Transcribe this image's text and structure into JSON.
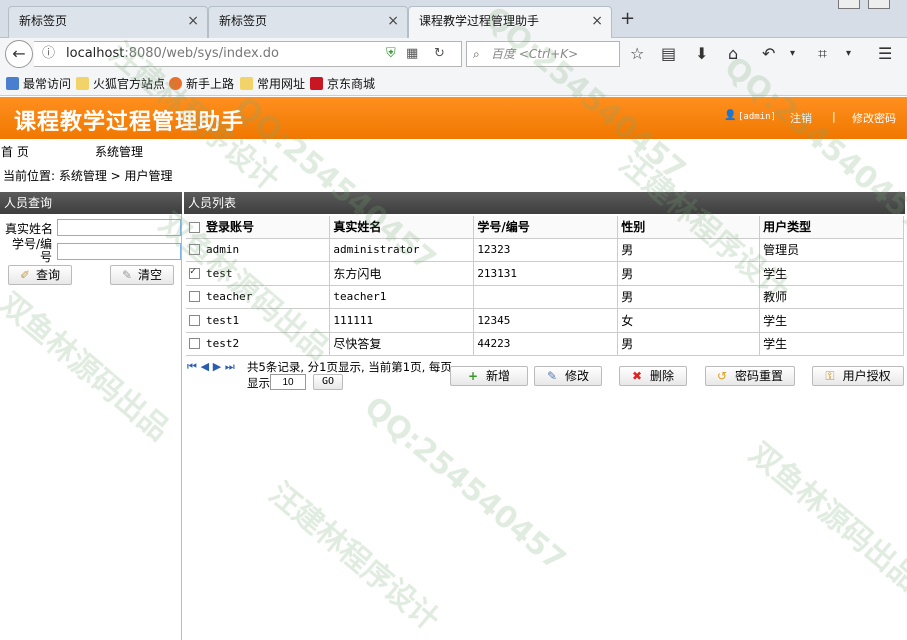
{
  "browser": {
    "tabs": [
      {
        "label": "新标签页",
        "active": false
      },
      {
        "label": "新标签页",
        "active": false
      },
      {
        "label": "课程教学过程管理助手",
        "active": true
      }
    ],
    "url_host": "localhost",
    "url_rest": ":8080/web/sys/index.do",
    "search_placeholder": "百度 <Ctrl+K>",
    "bookmarks": [
      "最常访问",
      "火狐官方站点",
      "新手上路",
      "常用网址",
      "京东商城"
    ]
  },
  "app": {
    "title": "课程教学过程管理助手",
    "user": "[admin]",
    "logout": "注销",
    "separator": "|",
    "change_password": "修改密码",
    "menu": [
      "首 页",
      "系统管理"
    ],
    "breadcrumb": "当前位置: 系统管理 > 用户管理"
  },
  "query_panel": {
    "title": "人员查询",
    "name_label": "真实姓名",
    "id_label": "学号/编号",
    "name_value": "",
    "id_value": "",
    "query_button": "查询",
    "clear_button": "清空"
  },
  "list_panel": {
    "title": "人员列表",
    "columns": [
      "登录账号",
      "真实姓名",
      "学号/编号",
      "性别",
      "用户类型"
    ],
    "rows": [
      {
        "checked": false,
        "account": "admin",
        "name": "administrator",
        "number": "12323",
        "gender": "男",
        "type": "管理员"
      },
      {
        "checked": true,
        "account": "test",
        "name": "东方闪电",
        "number": "213131",
        "gender": "男",
        "type": "学生"
      },
      {
        "checked": false,
        "account": "teacher",
        "name": "teacher1",
        "number": "",
        "gender": "男",
        "type": "教师"
      },
      {
        "checked": false,
        "account": "test1",
        "name": "111111",
        "number": "12345",
        "gender": "女",
        "type": "学生"
      },
      {
        "checked": false,
        "account": "test2",
        "name": "尽快答复",
        "number": "44223",
        "gender": "男",
        "type": "学生"
      }
    ],
    "pager_text": "共5条记录, 分1页显示, 当前第1页, 每页",
    "pager_show": "显示",
    "page_size": "10",
    "go_button": "GO",
    "actions": [
      "新增",
      "修改",
      "删除",
      "密码重置",
      "用户授权"
    ]
  },
  "watermarks": [
    "汪建林程序设计",
    "QQ:254540457",
    "双鱼林源码出品"
  ],
  "colors": {
    "header_orange": "#f28018",
    "panel_header": "#474747",
    "input_border": "#7eb4ea"
  }
}
